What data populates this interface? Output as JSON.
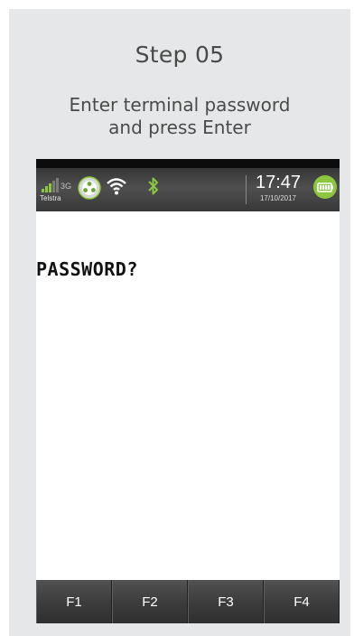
{
  "step": {
    "title": "Step 05",
    "instruction_line1": "Enter terminal password",
    "instruction_line2": "and press Enter"
  },
  "statusbar": {
    "carrier": "Telstra",
    "network": "3G",
    "time": "17:47",
    "date": "17/10/2017",
    "icons": [
      "signal-icon",
      "hub-icon",
      "wifi-icon",
      "bluetooth-icon",
      "battery-icon"
    ],
    "accent_color": "#8cc63f"
  },
  "screen": {
    "prompt": "PASSWORD?"
  },
  "fkeys": [
    {
      "label": "F1"
    },
    {
      "label": "F2"
    },
    {
      "label": "F3"
    },
    {
      "label": "F4"
    }
  ]
}
